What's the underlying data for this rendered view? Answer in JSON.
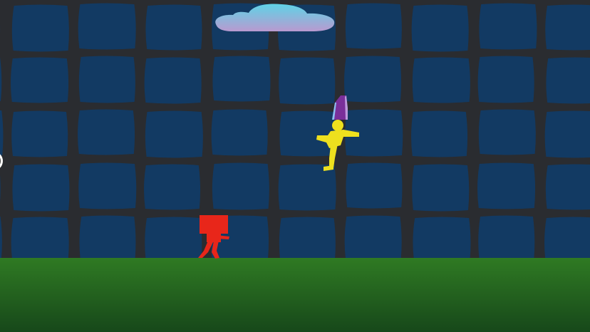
{
  "scene": {
    "wall_color": "#123a63",
    "mortar_color": "#2a2c30",
    "ground_top_color": "#2f7a23",
    "ground_bottom_color": "#17481a",
    "cloud_top_color": "#5fd3e6",
    "cloud_bottom_color": "#b99ad0"
  },
  "players": [
    {
      "name": "red-fighter",
      "color": "#e8261a",
      "pose": "running"
    },
    {
      "name": "yellow-fighter",
      "color": "#eee01e",
      "pose": "kicking",
      "hat_color": "#7a2f9a"
    }
  ],
  "icons": {
    "edge_button": "circle-button-icon"
  }
}
